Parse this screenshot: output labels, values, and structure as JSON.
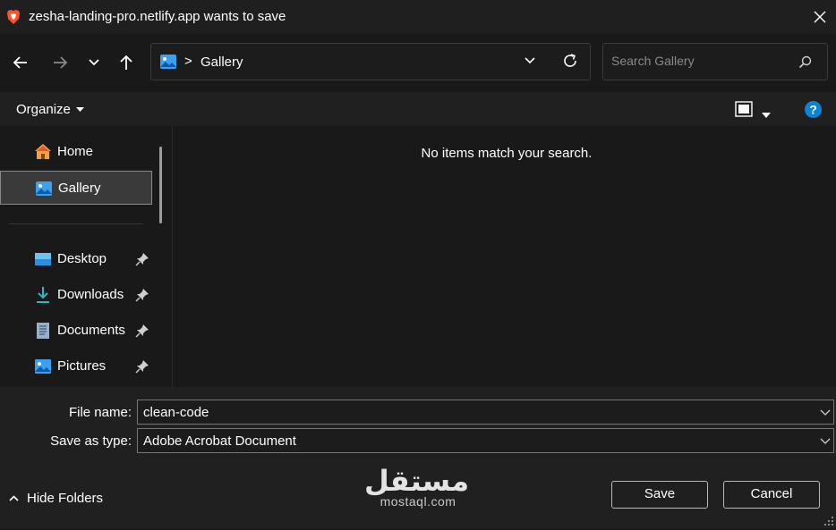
{
  "window": {
    "title": "zesha-landing-pro.netlify.app wants to save",
    "close_glyph": "✕"
  },
  "nav": {
    "back_icon": "arrow-left-icon",
    "forward_icon": "arrow-right-icon",
    "recent_icon": "chevron-down-icon",
    "up_icon": "arrow-up-icon"
  },
  "address": {
    "separator": ">",
    "location": "Gallery"
  },
  "search": {
    "placeholder": "Search Gallery"
  },
  "toolbar": {
    "organize_label": "Organize"
  },
  "sidebar": {
    "items": [
      {
        "label": "Home",
        "icon": "home-icon",
        "pinned": false
      },
      {
        "label": "Gallery",
        "icon": "gallery-icon",
        "pinned": false,
        "selected": true
      },
      {
        "label": "Desktop",
        "icon": "desktop-icon",
        "pinned": true
      },
      {
        "label": "Downloads",
        "icon": "download-icon",
        "pinned": true
      },
      {
        "label": "Documents",
        "icon": "document-icon",
        "pinned": true
      },
      {
        "label": "Pictures",
        "icon": "pictures-icon",
        "pinned": true
      }
    ]
  },
  "content": {
    "empty_message": "No items match your search."
  },
  "form": {
    "file_name_label": "File name:",
    "file_name_value": "clean-code",
    "save_type_label": "Save as type:",
    "save_type_value": "Adobe Acrobat Document"
  },
  "footer": {
    "hide_folders_label": "Hide Folders",
    "save_label": "Save",
    "cancel_label": "Cancel"
  },
  "watermark": {
    "logo_text": "مستقل",
    "url": "mostaql.com"
  },
  "colors": {
    "accent": "#0a84d6",
    "background": "#191919",
    "panel": "#202020"
  }
}
